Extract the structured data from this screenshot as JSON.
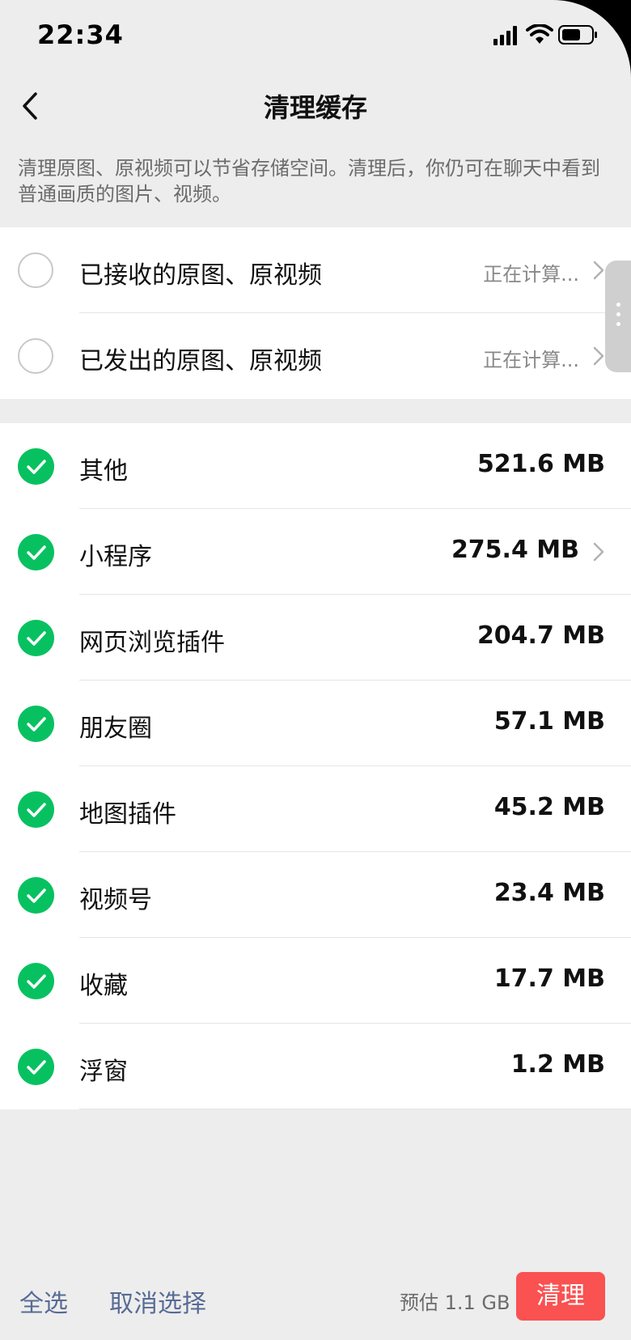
{
  "status_bar": {
    "time": "22:34",
    "icons": [
      "signal-icon",
      "wifi-icon",
      "battery-icon"
    ]
  },
  "nav": {
    "title": "清理缓存",
    "back_icon": "chevron-left-icon"
  },
  "description": "清理原图、原视频可以节省存储空间。清理后，你仍可在聊天中看到普通画质的图片、视频。",
  "original_media": [
    {
      "label": "已接收的原图、原视频",
      "status": "正在计算...",
      "selected": false
    },
    {
      "label": "已发出的原图、原视频",
      "status": "正在计算...",
      "selected": false
    }
  ],
  "cache_items": [
    {
      "label": "其他",
      "size": "521.6 MB",
      "selected": true,
      "has_chevron": false
    },
    {
      "label": "小程序",
      "size": "275.4 MB",
      "selected": true,
      "has_chevron": true
    },
    {
      "label": "网页浏览插件",
      "size": "204.7 MB",
      "selected": true,
      "has_chevron": false
    },
    {
      "label": "朋友圈",
      "size": "57.1 MB",
      "selected": true,
      "has_chevron": false
    },
    {
      "label": "地图插件",
      "size": "45.2 MB",
      "selected": true,
      "has_chevron": false
    },
    {
      "label": "视频号",
      "size": "23.4 MB",
      "selected": true,
      "has_chevron": false
    },
    {
      "label": "收藏",
      "size": "17.7 MB",
      "selected": true,
      "has_chevron": false
    },
    {
      "label": "浮窗",
      "size": "1.2 MB",
      "selected": true,
      "has_chevron": false
    }
  ],
  "footer": {
    "select_all": "全选",
    "deselect": "取消选择",
    "estimate": "预估 1.1 GB",
    "clean_button": "清理"
  },
  "colors": {
    "accent_green": "#07c160",
    "danger_red": "#fa5151",
    "link_blue": "#576b95",
    "background": "#ededed"
  }
}
